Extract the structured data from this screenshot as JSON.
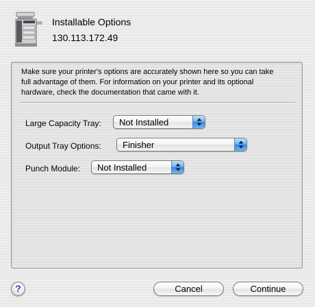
{
  "header": {
    "icon": "printer-icon",
    "title": "Installable Options",
    "address": "130.113.172.49"
  },
  "panel": {
    "info_text": "Make sure your printer's options are accurately shown here so you can take\nfull advantage of them.  For information on your printer and its optional\nhardware, check the documentation that came with it.",
    "options": [
      {
        "label": "Large Capacity Tray:",
        "value": "Not Installed"
      },
      {
        "label": "Output Tray Options:",
        "value": "Finisher"
      },
      {
        "label": "Punch Module:",
        "value": "Not Installed"
      }
    ]
  },
  "buttons": {
    "help_label": "?",
    "cancel_label": "Cancel",
    "continue_label": "Continue"
  },
  "colors": {
    "popup_arrow_accent": "#3d86e0",
    "window_background": "#ececec"
  }
}
